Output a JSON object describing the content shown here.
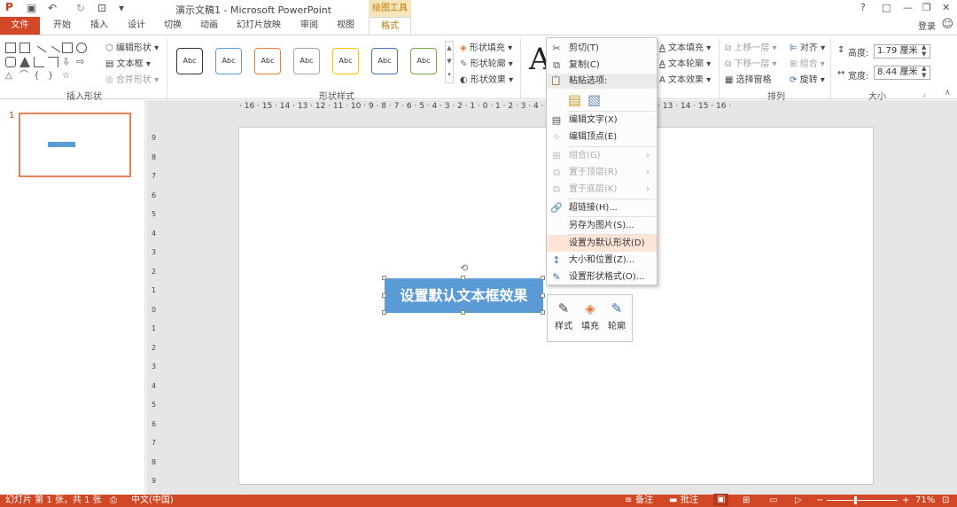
{
  "titlebar": {
    "title": "演示文稿1 - Microsoft PowerPoint",
    "contextual_tab": "绘图工具",
    "help": "?",
    "window_buttons": [
      "□",
      "—",
      "❐",
      "✕"
    ]
  },
  "tabs": {
    "file": "文件",
    "items": [
      "开始",
      "插入",
      "设计",
      "切换",
      "动画",
      "幻灯片放映",
      "审阅",
      "视图",
      "格式"
    ],
    "login": "登录"
  },
  "ribbon": {
    "insert_shapes": {
      "edit_shape": "编辑形状",
      "textbox": "文本框",
      "merge_shapes": "合并形状",
      "label": "插入形状"
    },
    "shape_styles": {
      "sample": "Abc",
      "fill": "形状填充",
      "outline": "形状轮廓",
      "effects": "形状效果",
      "label": "形状样式"
    },
    "wordart": {
      "big_letter": "A",
      "text_fill": "文本填充",
      "text_outline": "文本轮廓",
      "text_effects": "文本效果"
    },
    "arrange": {
      "bring_forward": "上移一层",
      "send_backward": "下移一层",
      "selection_pane": "选择窗格",
      "align": "对齐",
      "group": "组合",
      "rotate": "旋转",
      "label": "排列"
    },
    "size": {
      "height_label": "高度:",
      "height_value": "1.79 厘米",
      "width_label": "宽度:",
      "width_value": "8.44 厘米",
      "label": "大小"
    }
  },
  "ruler": {
    "horizontal": "· 16 · 15 · 14 · 13 · 12 · 11 · 10 · 9 · 8 · 7 · 6 · 5 · 4 · 3 · 2 · 1 · 0 · 1 · 2 · 3 · 4 · 5 · 6 · 7 · 8 · 9 · 10 · 11 · 12 · 13 · 14 · 15 · 16 ·",
    "vertical": [
      "9",
      "8",
      "7",
      "6",
      "5",
      "4",
      "3",
      "2",
      "1",
      "0",
      "1",
      "2",
      "3",
      "4",
      "5",
      "6",
      "7",
      "8",
      "9"
    ]
  },
  "slides_pane": {
    "number": "1"
  },
  "slide": {
    "textbox_text": "设置默认文本框效果"
  },
  "context_menu": {
    "cut": "剪切(T)",
    "copy": "复制(C)",
    "paste_options": "粘贴选项:",
    "edit_text": "编辑文字(X)",
    "edit_points": "编辑顶点(E)",
    "group": "组合(G)",
    "bring_to_front": "置于顶层(R)",
    "send_to_back": "置于底层(K)",
    "hyperlink": "超链接(H)...",
    "save_as_picture": "另存为图片(S)...",
    "set_default_shape": "设置为默认形状(D)",
    "size_position": "大小和位置(Z)...",
    "format_shape": "设置形状格式(O)..."
  },
  "mini_toolbar": {
    "style": "样式",
    "fill": "填充",
    "outline": "轮廓"
  },
  "status_bar": {
    "slide_info": "幻灯片 第 1 张，共 1 张",
    "language": "中文(中国)",
    "notes": "备注",
    "comments": "批注",
    "zoom": "71%"
  }
}
